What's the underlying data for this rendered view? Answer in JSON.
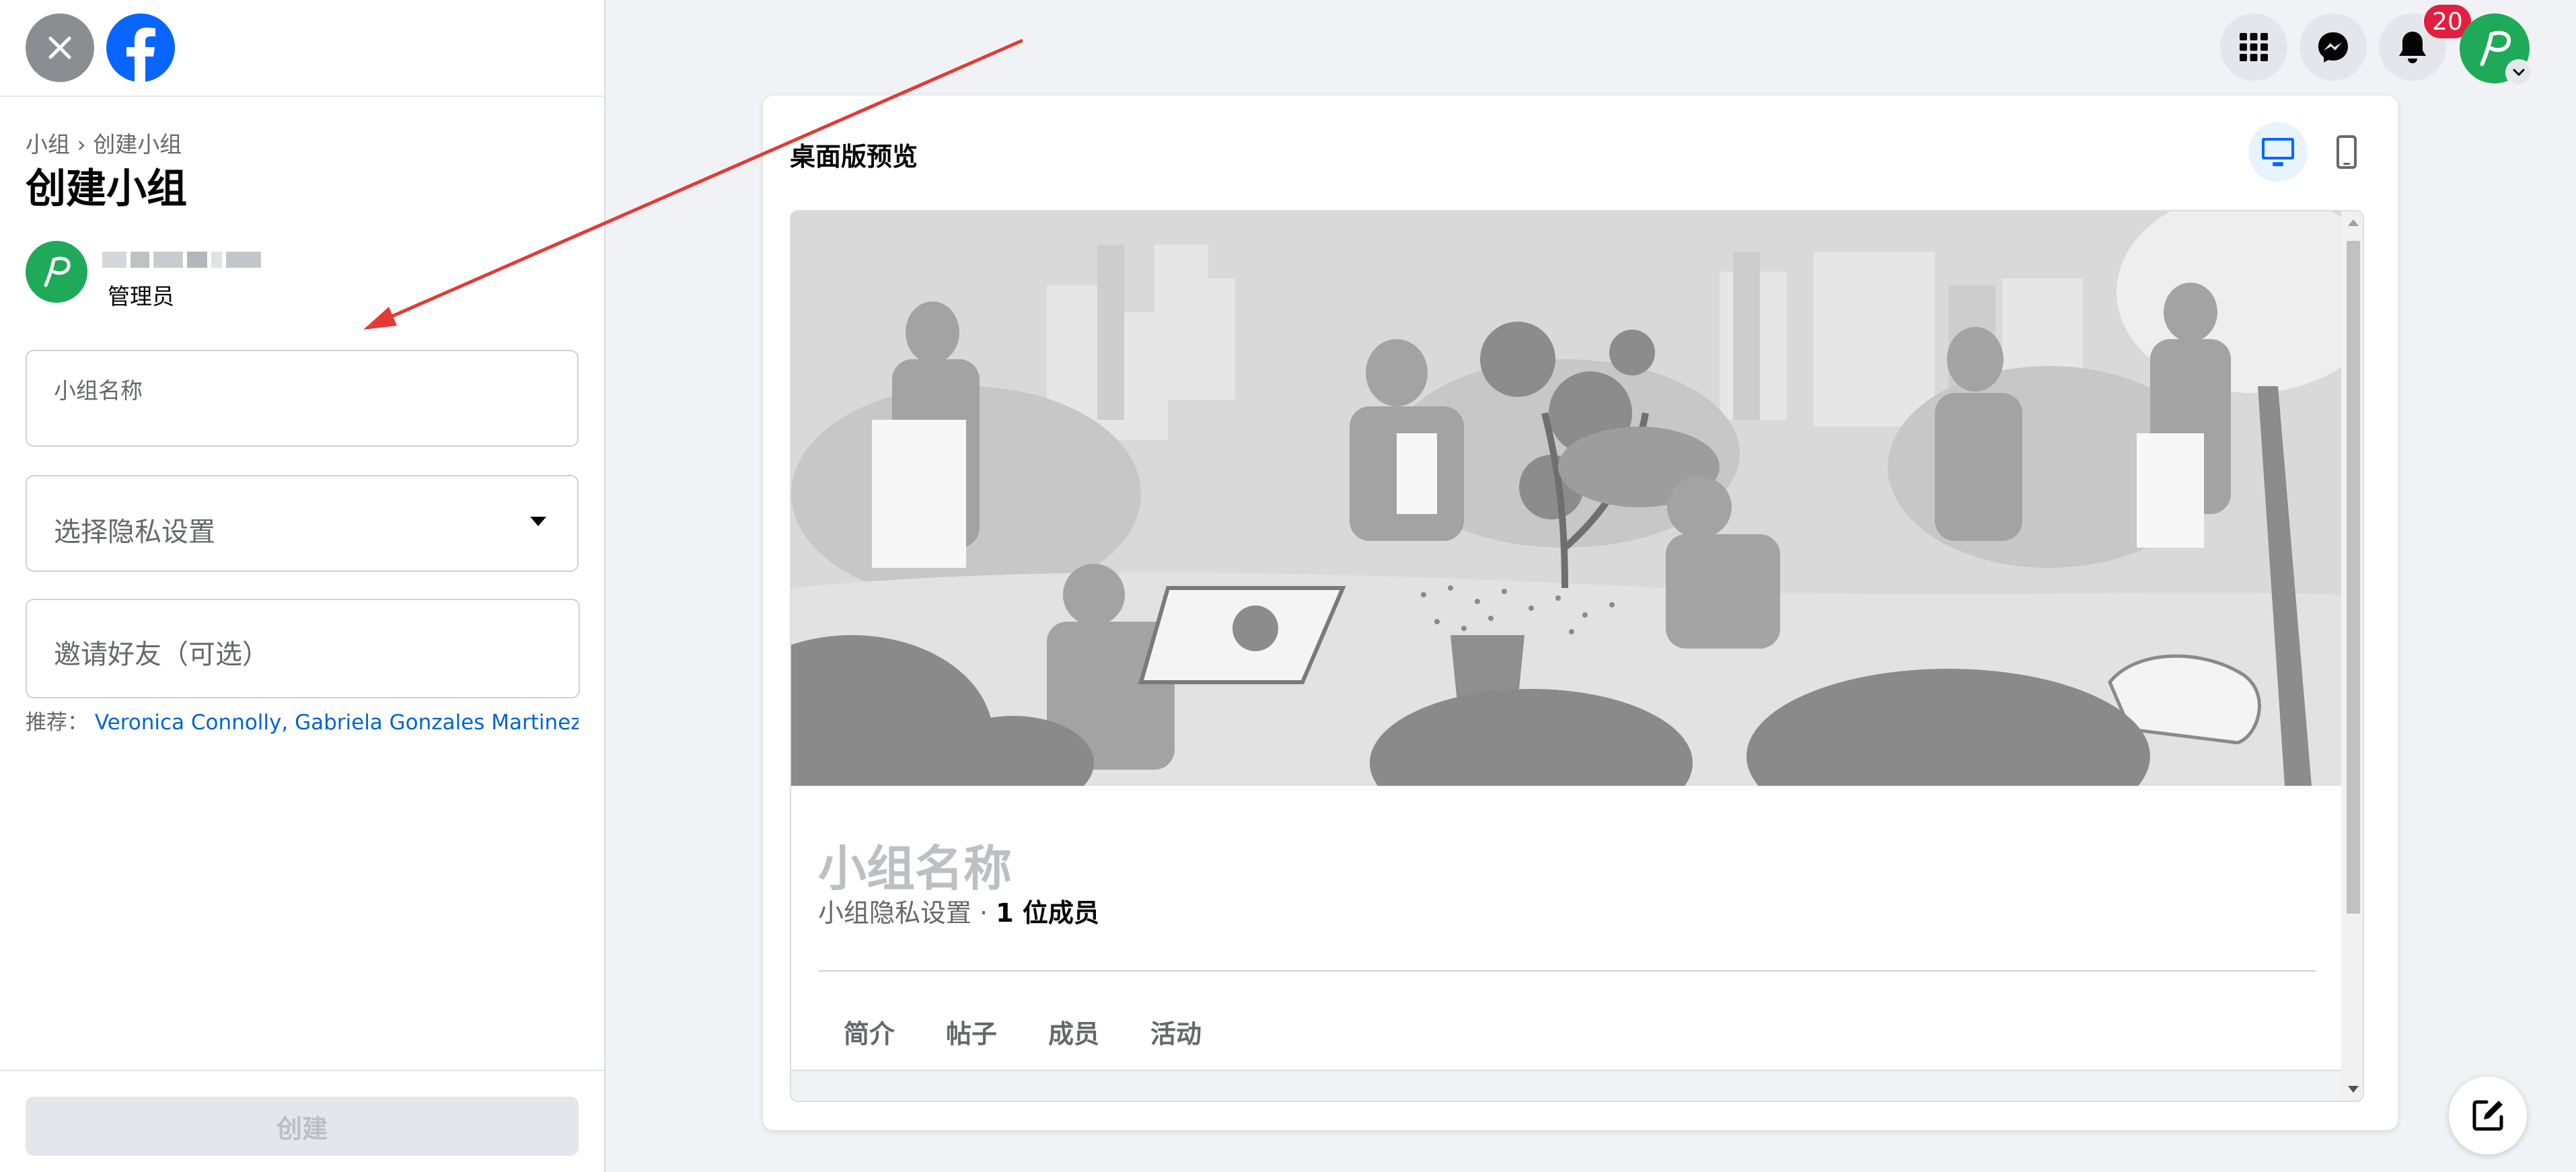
{
  "header": {
    "close_icon": "close-icon",
    "logo_icon": "facebook-logo"
  },
  "left_panel": {
    "breadcrumb": [
      "小组",
      "›",
      "创建小组"
    ],
    "title": "创建小组",
    "admin": {
      "role": "管理员",
      "name_blurred": true
    },
    "fields": {
      "group_name_label": "小组名称",
      "privacy_label": "选择隐私设置",
      "invite_label": "邀请好友（可选）"
    },
    "suggestions": {
      "prefix": "推荐：",
      "names": "Veronica Connolly, Gabriela Gonzales Martinez, ..."
    },
    "create_button": "创建"
  },
  "top_nav": {
    "icons": [
      "menu-grid-icon",
      "messenger-icon",
      "notifications-icon"
    ],
    "notification_count": "20"
  },
  "preview": {
    "title": "桌面版预览",
    "active_device": "desktop",
    "group_name_placeholder": "小组名称",
    "privacy_placeholder": "小组隐私设置",
    "separator": " · ",
    "member_count": "1 位成员",
    "tabs": [
      "简介",
      "帖子",
      "成员",
      "活动"
    ]
  },
  "colors": {
    "accent_blue": "#0866ff",
    "link_blue": "#0064d1",
    "badge_red": "#e41e3f",
    "avatar_green": "#1faa59",
    "annotation_arrow": "#e53935"
  }
}
